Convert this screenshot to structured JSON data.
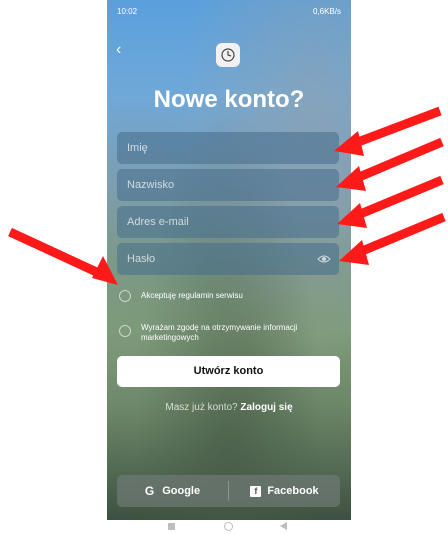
{
  "status_bar": {
    "time": "10:02",
    "network": "0,6KB/s"
  },
  "screen": {
    "title": "Nowe konto?",
    "fields": {
      "name_placeholder": "Imię",
      "surname_placeholder": "Nazwisko",
      "email_placeholder": "Adres e-mail",
      "password_placeholder": "Hasło"
    },
    "consents": {
      "terms": "Akceptuję regulamin serwisu",
      "marketing": "Wyrażam zgodę na otrzymywanie informacji marketingowych"
    },
    "create_button": "Utwórz konto",
    "login_prompt": "Masz już konto?",
    "login_link": "Zaloguj się",
    "social": {
      "google_label": "Google",
      "facebook_label": "Facebook"
    }
  },
  "icons": [
    "chevron-left-icon",
    "app-logo-icon",
    "eye-icon",
    "google-icon",
    "facebook-icon"
  ],
  "colors": {
    "annotation_arrow": "#ff1a1a",
    "primary_button_bg": "#ffffff",
    "field_bg": "rgba(70,110,140,0.55)"
  }
}
